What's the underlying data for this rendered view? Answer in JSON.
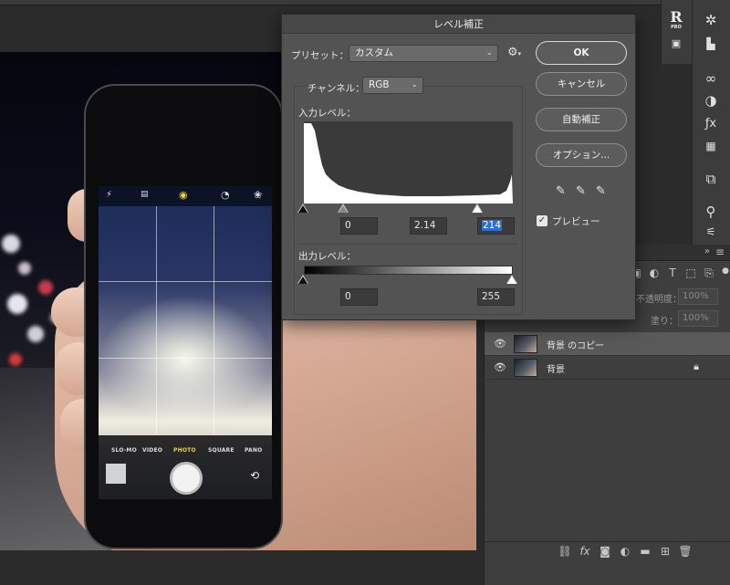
{
  "dialog": {
    "title": "レベル補正",
    "preset_label": "プリセット：",
    "preset_value": "カスタム",
    "channel_label": "チャンネル：",
    "channel_value": "RGB",
    "input_levels_label": "入力レベル：",
    "input_black": "0",
    "input_gamma": "2.14",
    "input_white": "214",
    "output_levels_label": "出力レベル：",
    "output_black": "0",
    "output_white": "255",
    "buttons": {
      "ok": "OK",
      "cancel": "キャンセル",
      "auto": "自動補正",
      "options": "オプション..."
    },
    "preview_label": "プレビュー",
    "preview_checked": true
  },
  "camera_app": {
    "modes": [
      "SLO-MO",
      "VIDEO",
      "PHOTO",
      "SQUARE",
      "PANO"
    ],
    "active_mode": "PHOTO"
  },
  "layers": {
    "opacity_label": "不透明度：",
    "opacity_value": "100%",
    "fill_label": "塗り：",
    "fill_value": "100%",
    "items": [
      {
        "name": "背景 のコピー",
        "selected": true,
        "locked": false
      },
      {
        "name": "背景",
        "selected": false,
        "locked": true
      }
    ]
  },
  "app": {
    "logo_letter": "R",
    "logo_sub": "PRO"
  },
  "colors": {
    "dialog_bg": "#535353",
    "selection_highlight": "#2d6fd1",
    "panel_bg": "#3e3e3e"
  }
}
